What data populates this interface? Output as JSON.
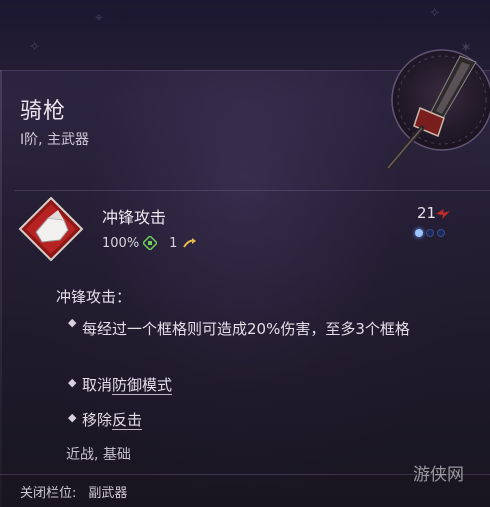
{
  "item": {
    "name": "骑枪",
    "subtitle": "I阶, 主武器",
    "weapon_icon": "lance-icon"
  },
  "skill": {
    "icon": "charge-attack-icon",
    "name": "冲锋攻击",
    "accuracy": "100%",
    "accuracy_icon": "crosshair-icon",
    "movement": "1",
    "movement_icon": "movement-arrow-icon",
    "cost": "21",
    "cost_icon": "bolt-icon",
    "charges": [
      true,
      false,
      false
    ]
  },
  "description": {
    "title": "冲锋攻击：",
    "bullets": [
      {
        "text": "每经过一个框格则可造成20%伤害，至多3个框格"
      },
      {
        "prefix": "取消",
        "link": "防御模式"
      },
      {
        "prefix": "移除",
        "link": "反击"
      }
    ]
  },
  "tags": "近战, 基础",
  "footer": {
    "label": "关闭栏位:",
    "value": "副武器"
  },
  "watermark": "游侠网",
  "colors": {
    "accent_red": "#c42a2a",
    "accent_green": "#6fcf5a",
    "accent_gold": "#e4b84a",
    "pip_active": "#9cc4ff"
  }
}
